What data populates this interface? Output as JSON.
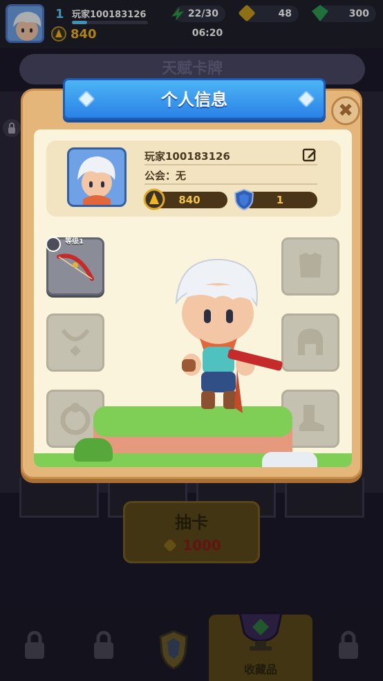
{
  "topbar": {
    "level": "1",
    "player_name": "玩家100183126",
    "xp_fraction": 0.2,
    "power": "840",
    "energy": "22/30",
    "gold": "48",
    "gems": "300",
    "timer": "06:20"
  },
  "background": {
    "talent_title": "天赋卡牌",
    "draw_label": "抽卡",
    "draw_cost": "1000",
    "collection_label": "收藏品"
  },
  "modal": {
    "title": "个人信息",
    "player_name": "玩家100183126",
    "guild": "公会：无",
    "power": "840",
    "rank": "1",
    "weapon_level": "等级1"
  },
  "colors": {
    "ribbon_blue": "#2b82e6",
    "panel_wood": "#e5b67a",
    "panel_cream": "#fbf4dc",
    "power_gold": "#f2c44a"
  }
}
